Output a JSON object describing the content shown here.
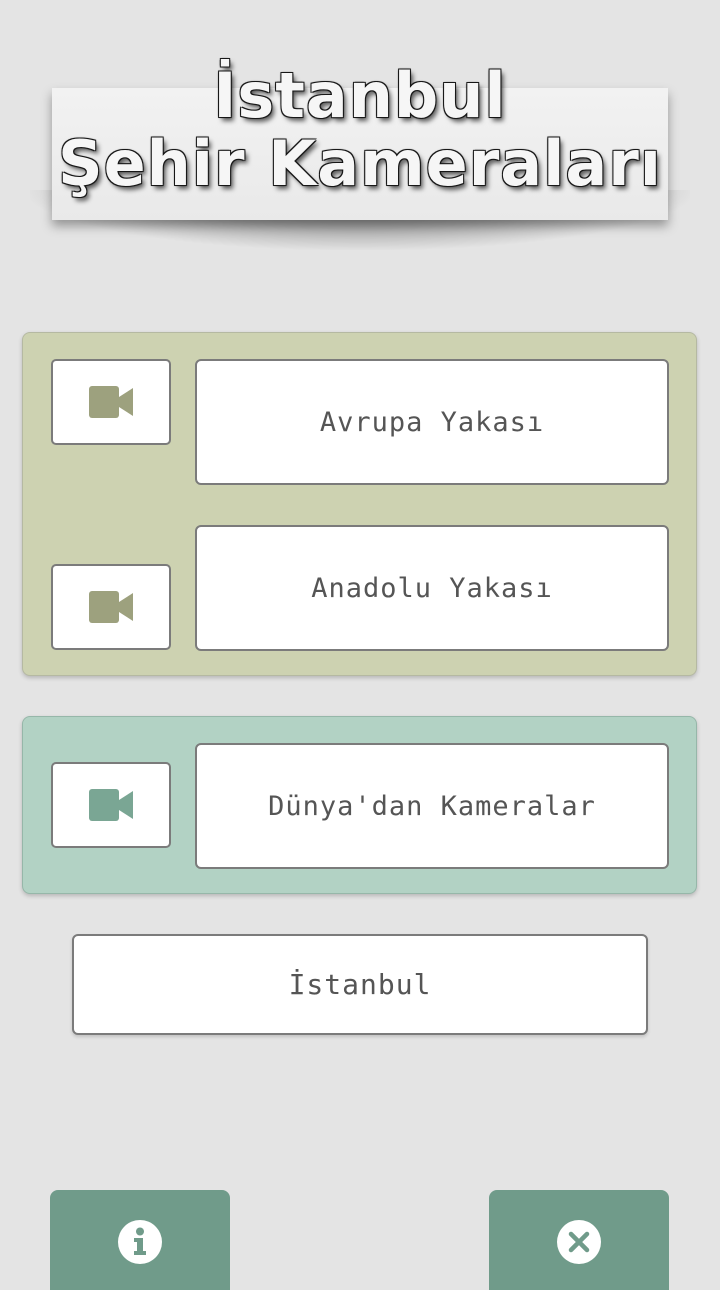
{
  "header": {
    "title_line1": "İstanbul",
    "title_line2": "Şehir Kameraları"
  },
  "groups": {
    "local": {
      "color": "#cdd2b1",
      "icon_color": "#9da17e",
      "items": [
        {
          "label": "Avrupa Yakası",
          "icon": "video-camera-icon"
        },
        {
          "label": "Anadolu Yakası",
          "icon": "video-camera-icon"
        }
      ]
    },
    "world": {
      "color": "#b2d2c4",
      "icon_color": "#7aa694",
      "items": [
        {
          "label": "Dünya'dan Kameralar",
          "icon": "video-camera-icon"
        }
      ]
    }
  },
  "istanbul_button": {
    "label": "İstanbul"
  },
  "bottom_bar": {
    "color": "#709b8a",
    "info_icon": "info-icon",
    "close_icon": "close-icon"
  }
}
